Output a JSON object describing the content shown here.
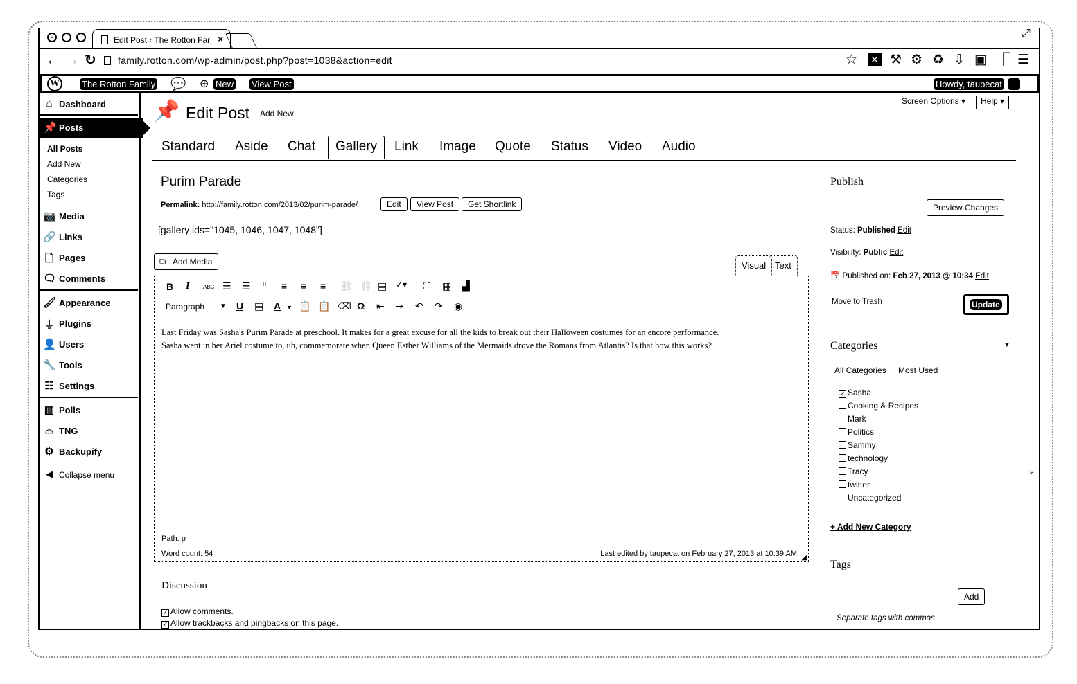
{
  "browser": {
    "tab_title": "Edit Post ‹ The Rotton Farr",
    "url": "family.rotton.com/wp-admin/post.php?post=1038&action=edit"
  },
  "adminbar": {
    "site_name": "The Rotton Family",
    "new_label": "New",
    "view_post_label": "View Post",
    "howdy": "Howdy, taupecat"
  },
  "sidebar": {
    "dashboard": "Dashboard",
    "posts": "Posts",
    "posts_sub": [
      "All Posts",
      "Add New",
      "Categories",
      "Tags"
    ],
    "media": "Media",
    "links": "Links",
    "pages": "Pages",
    "comments": "Comments",
    "appearance": "Appearance",
    "plugins": "Plugins",
    "users": "Users",
    "tools": "Tools",
    "settings": "Settings",
    "polls": "Polls",
    "tng": "TNG",
    "backupify": "Backupify",
    "collapse": "Collapse menu"
  },
  "header": {
    "screen_options": "Screen Options ▾",
    "help": "Help ▾",
    "title": "Edit Post",
    "add_new": "Add New"
  },
  "format_tabs": [
    "Standard",
    "Aside",
    "Chat",
    "Gallery",
    "Link",
    "Image",
    "Quote",
    "Status",
    "Video",
    "Audio"
  ],
  "post": {
    "title": "Purim Parade",
    "permalink_label": "Permalink:",
    "permalink_url": "http://family.rotton.com/2013/02/purim-parade/",
    "edit_btn": "Edit",
    "view_post_btn": "View Post",
    "shortlink_btn": "Get Shortlink",
    "shortcode": "[gallery ids=\"1045, 1046, 1047, 1048\"]",
    "add_media": "Add Media",
    "visual_tab": "Visual",
    "text_tab": "Text",
    "format_select": "Paragraph",
    "body_line1": "Last Friday was Sasha's Purim Parade at preschool.  It makes for a great excuse for all the kids to break out their Halloween costumes for an encore performance.",
    "body_line2": "Sasha went in her Ariel costume to, uh, commemorate when Queen Esther Williams of the Mermaids drove the Romans from Atlantis? Is that how this works?",
    "path": "Path: p",
    "word_count": "Word count: 54",
    "last_edited": "Last edited by taupecat on February 27, 2013 at 10:39 AM"
  },
  "discussion": {
    "title": "Discussion",
    "allow_comments": "Allow comments.",
    "allow_prefix": "Allow ",
    "trackbacks_link": "trackbacks and pingbacks",
    "allow_suffix": " on this page."
  },
  "publish": {
    "title": "Publish",
    "preview": "Preview Changes",
    "status_label": "Status:",
    "status_value": "Published",
    "visibility_label": "Visibility:",
    "visibility_value": "Public",
    "published_label": "Published on:",
    "published_value": "Feb 27, 2013 @ 10:34",
    "edit": "Edit",
    "trash": "Move to Trash",
    "update": "Update"
  },
  "categories": {
    "title": "Categories",
    "tab_all": "All Categories",
    "tab_most": "Most Used",
    "items": [
      {
        "label": "Sasha",
        "checked": true
      },
      {
        "label": "Cooking & Recipes",
        "checked": false
      },
      {
        "label": "Mark",
        "checked": false
      },
      {
        "label": "Politics",
        "checked": false
      },
      {
        "label": "Sammy",
        "checked": false
      },
      {
        "label": "technology",
        "checked": false
      },
      {
        "label": "Tracy",
        "checked": false
      },
      {
        "label": "twitter",
        "checked": false
      },
      {
        "label": "Uncategorized",
        "checked": false
      }
    ],
    "add_new": "+ Add New Category"
  },
  "tags": {
    "title": "Tags",
    "add": "Add",
    "hint": "Separate tags with commas"
  }
}
